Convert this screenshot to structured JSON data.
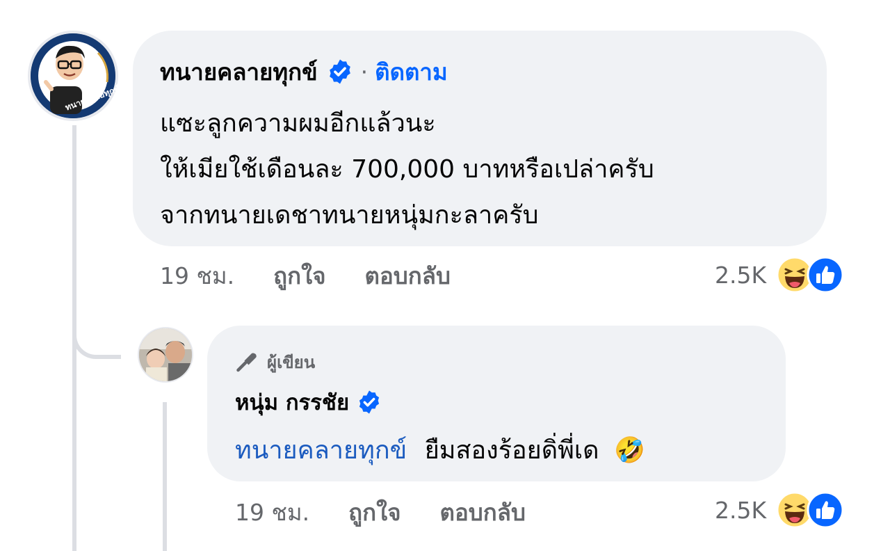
{
  "comment": {
    "author": "ทนายคลายทุกข์",
    "follow_label": "ติดตาม",
    "dot": "·",
    "lines": [
      "แซะลูกความผมอีกแล้วนะ",
      "ให้เมียใช้เดือนละ 700,000 บาทหรือเปล่าครับ",
      "จากทนายเดชาทนายหนุ่มกะลาครับ"
    ],
    "avatar_caption": "ทนายคลายทุกข์",
    "time": "19 ชม.",
    "like_label": "ถูกใจ",
    "reply_label": "ตอบกลับ",
    "reaction_count": "2.5K",
    "reactions": [
      "haha-icon",
      "like-icon"
    ]
  },
  "reply": {
    "badge": "ผู้เขียน",
    "author": "หนุ่ม กรรชัย",
    "mention": "ทนายคลายทุกข์",
    "text": "ยืมสองร้อยดิ่พี่เด",
    "emoji": "🤣",
    "time": "19 ชม.",
    "like_label": "ถูกใจ",
    "reply_label": "ตอบกลับ",
    "reaction_count": "2.5K",
    "reactions": [
      "haha-icon",
      "like-icon"
    ]
  },
  "colors": {
    "bubble": "#f0f2f5",
    "link": "#0866ff",
    "mention": "#1b5bbf",
    "secondary_text": "#65676b",
    "thread_line": "#dcdee3"
  }
}
